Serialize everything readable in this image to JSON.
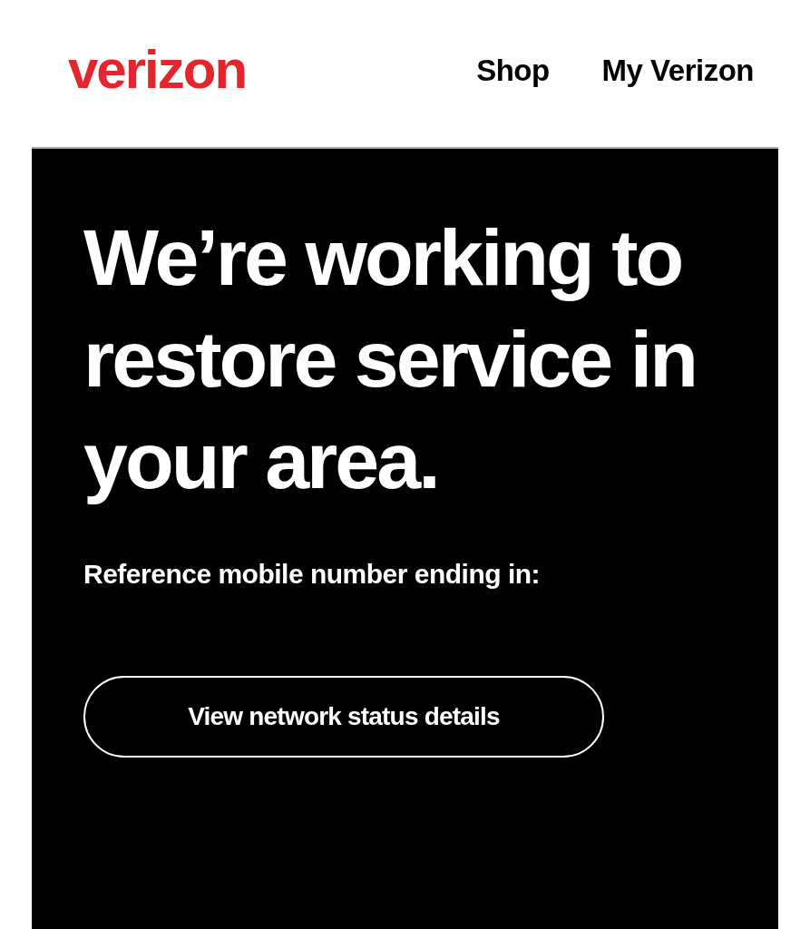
{
  "header": {
    "logo": "verizon",
    "nav": [
      "Shop",
      "My Verizon"
    ]
  },
  "alert": {
    "headline": "We’re working to restore service in your area.",
    "reference_label": "Reference mobile number ending in:",
    "button": "View network status details"
  }
}
